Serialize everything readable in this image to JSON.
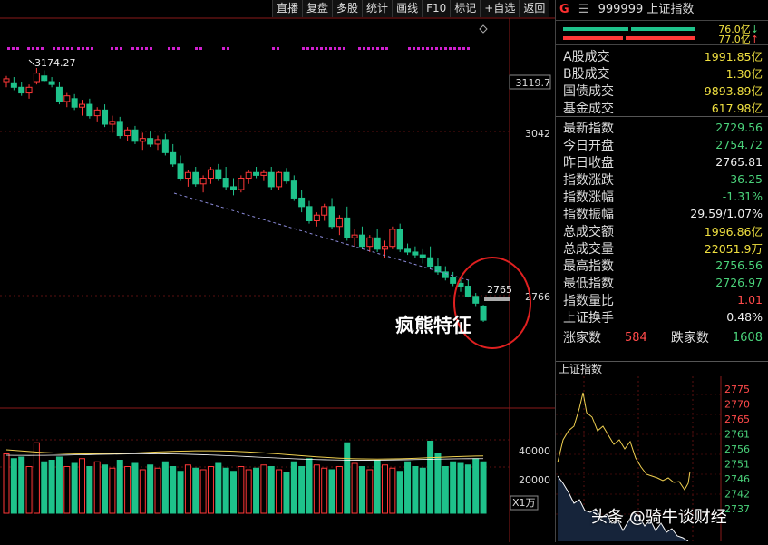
{
  "toolbar": [
    "直播",
    "复盘",
    "多股",
    "统计",
    "画线",
    "F10",
    "标记",
    "+自选",
    "返回"
  ],
  "chart": {
    "high_label": "3174.27",
    "axis_labels": [
      "3119.7",
      "3042",
      "2766"
    ],
    "last_price_tag": "2765",
    "annotation": "疯熊特征",
    "volume_axis": [
      "40000",
      "20000"
    ],
    "volume_unit": "X1万",
    "colors": {
      "up": "#ff3838",
      "down": "#1ec28b",
      "trend": "#8a8ad8",
      "circle": "#e02020",
      "ma": "#f0d050"
    }
  },
  "quote": {
    "g_mark": "G",
    "code_name": "999999 上证指数",
    "bar1_value": "76.0亿",
    "bar1_arrow": "↓",
    "bar2_value": "77.0亿",
    "bar2_arrow": "↑",
    "turnover": [
      {
        "label": "A股成交",
        "value": "1991.85亿"
      },
      {
        "label": "B股成交",
        "value": "1.30亿"
      },
      {
        "label": "国债成交",
        "value": "9893.89亿"
      },
      {
        "label": "基金成交",
        "value": "617.98亿"
      }
    ],
    "stats": [
      {
        "label": "最新指数",
        "value": "2729.56",
        "color": "green"
      },
      {
        "label": "今日开盘",
        "value": "2754.72",
        "color": "green"
      },
      {
        "label": "昨日收盘",
        "value": "2765.81",
        "color": "white"
      },
      {
        "label": "指数涨跌",
        "value": "-36.25",
        "color": "green"
      },
      {
        "label": "指数涨幅",
        "value": "-1.31%",
        "color": "green"
      },
      {
        "label": "指数振幅",
        "value": "29.59/1.07%",
        "color": "white"
      },
      {
        "label": "总成交额",
        "value": "1996.86亿",
        "color": "yellow"
      },
      {
        "label": "总成交量",
        "value": "22051.9万",
        "color": "yellow"
      },
      {
        "label": "最高指数",
        "value": "2756.56",
        "color": "green"
      },
      {
        "label": "最低指数",
        "value": "2726.97",
        "color": "green"
      },
      {
        "label": "指数量比",
        "value": "1.01",
        "color": "red"
      },
      {
        "label": "上证换手",
        "value": "0.48%",
        "color": "white"
      }
    ],
    "breadth": {
      "up_label": "涨家数",
      "up_value": "584",
      "down_label": "跌家数",
      "down_value": "1608"
    }
  },
  "mini": {
    "title": "上证指数",
    "axis": [
      "2775",
      "2770",
      "2765",
      "2761",
      "2756",
      "2751",
      "2746",
      "2742",
      "2737"
    ]
  },
  "watermark": "头条 @骑牛谈财经"
}
